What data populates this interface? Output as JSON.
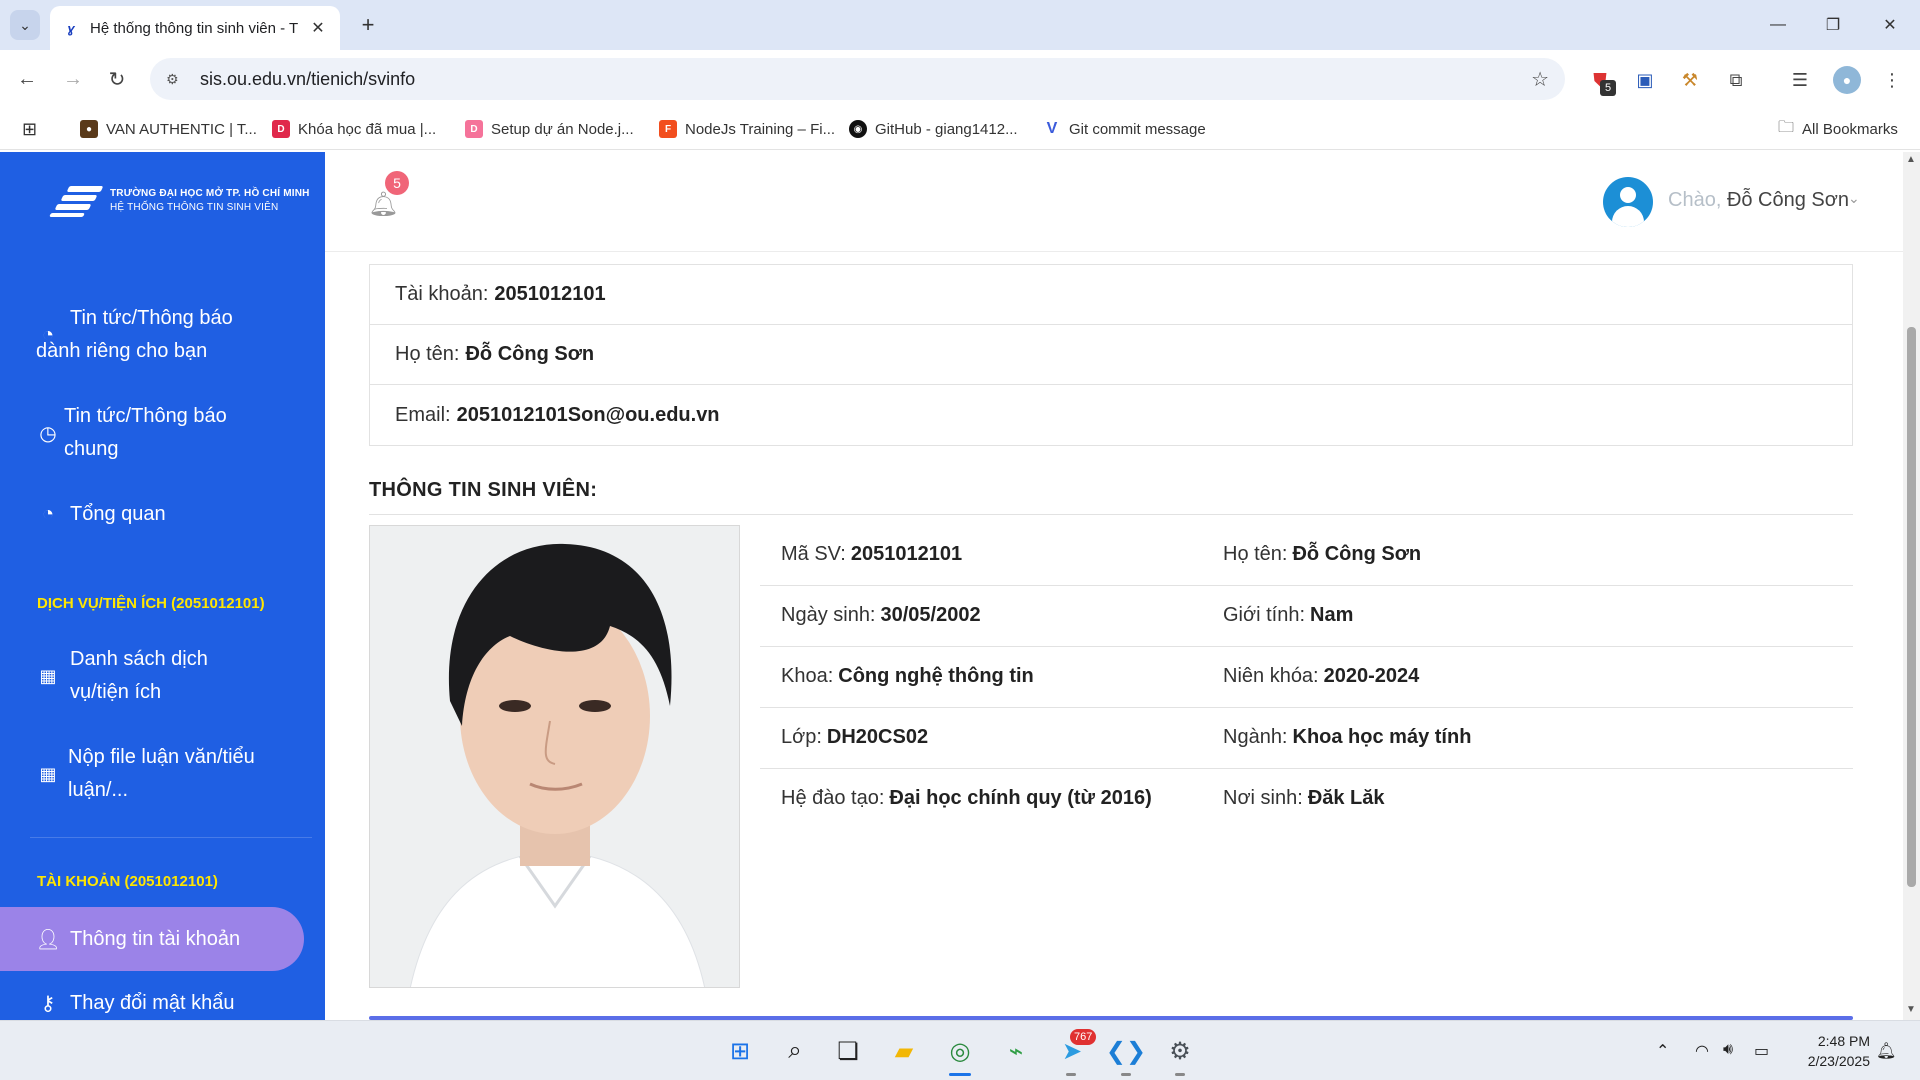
{
  "browser": {
    "tab_title": "Hệ thống thông tin sinh viên - T",
    "url": "sis.ou.edu.vn/tienich/svinfo",
    "bookmarks": [
      {
        "label": "VAN AUTHENTIC | T...",
        "color": "#5a3a1a"
      },
      {
        "label": "Khóa học đã mua |...",
        "color": "#e0284b"
      },
      {
        "label": "Setup dự án Node.j...",
        "color": "#f5739a"
      },
      {
        "label": "NodeJs Training – Fi...",
        "color": "#f24e1e"
      },
      {
        "label": "GitHub - giang1412...",
        "color": "#111111"
      },
      {
        "label": "Git commit message",
        "color": "#3b5bdb"
      }
    ],
    "all_bookmarks": "All Bookmarks",
    "extension_badge": "5"
  },
  "sidebar": {
    "logo_line1": "TRƯỜNG ĐẠI HỌC MỞ TP. HỒ CHÍ MINH",
    "logo_line2": "HỆ THỐNG THÔNG TIN SINH VIÊN",
    "items": [
      {
        "l1": "Tin tức/Thông báo",
        "l2": "dành riêng cho bạn",
        "icon": "dashboard-icon"
      },
      {
        "l1": "Tin tức/Thông báo",
        "l2": "chung",
        "icon": "clock-icon"
      },
      {
        "l1": "Tổng quan",
        "icon": "dashboard-icon"
      }
    ],
    "section_services": "DỊCH VỤ/TIỆN ÍCH (2051012101)",
    "service_items": [
      {
        "l1": "Danh sách dịch",
        "l2": "vụ/tiện ích",
        "icon": "grid-icon"
      },
      {
        "l1": "Nộp file luận văn/tiểu",
        "l2": "luận/...",
        "icon": "grid-icon"
      }
    ],
    "section_account": "TÀI KHOẢN (2051012101)",
    "account_items": [
      {
        "label": "Thông tin tài khoản",
        "icon": "user-icon",
        "active": true
      },
      {
        "label": "Thay đổi mật khẩu",
        "icon": "key-icon"
      }
    ],
    "colors": {
      "bg": "#1f5fe3",
      "section": "#ffe600",
      "active": "#9b83e8"
    }
  },
  "header": {
    "notification_count": "5",
    "greeting": "Chào,",
    "user_name": "Đỗ Công Sơn"
  },
  "account": {
    "rows": [
      {
        "label": "Tài khoản:",
        "value": "2051012101"
      },
      {
        "label": "Họ tên:",
        "value": "Đỗ Công Sơn"
      },
      {
        "label": "Email:",
        "value": "2051012101Son@ou.edu.vn"
      }
    ]
  },
  "student": {
    "section_title": "THÔNG TIN SINH VIÊN:",
    "rows": [
      {
        "left_label": "Mã SV:",
        "left_value": "2051012101",
        "right_label": "Họ tên:",
        "right_value": "Đỗ Công Sơn"
      },
      {
        "left_label": "Ngày sinh:",
        "left_value": "30/05/2002",
        "right_label": "Giới tính:",
        "right_value": "Nam"
      },
      {
        "left_label": "Khoa:",
        "left_value": "Công nghệ thông tin",
        "right_label": "Niên khóa:",
        "right_value": "2020-2024"
      },
      {
        "left_label": "Lớp:",
        "left_value": "DH20CS02",
        "right_label": "Ngành:",
        "right_value": "Khoa học máy tính"
      },
      {
        "left_label": "Hệ đào tạo:",
        "left_value": "Đại học chính quy (từ 2016)",
        "right_label": "Nơi sinh:",
        "right_value": "Đăk Lăk"
      }
    ]
  },
  "taskbar": {
    "telegram_badge": "767",
    "time": "2:48 PM",
    "date": "2/23/2025"
  }
}
